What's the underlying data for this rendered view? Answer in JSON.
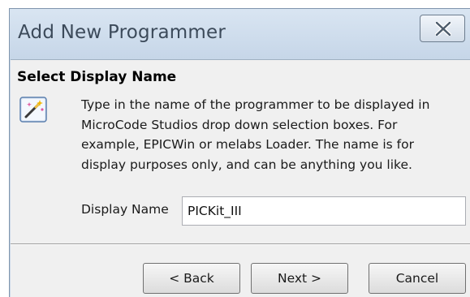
{
  "window": {
    "title": "Add New Programmer",
    "close_icon": "close-icon"
  },
  "section": {
    "title": "Select Display Name",
    "icon": "wizard-wand-icon",
    "description_lines": [
      "Type in the name of the programmer to be displayed in",
      "MicroCode Studios drop down selection boxes.  For",
      "example, EPICWin or melabs Loader. The name is for",
      "display purposes only, and can be anything you like."
    ]
  },
  "display_name": {
    "label": "Display Name",
    "value": "PICKit_III"
  },
  "buttons": {
    "back": "< Back",
    "next": "Next >",
    "cancel": "Cancel"
  }
}
